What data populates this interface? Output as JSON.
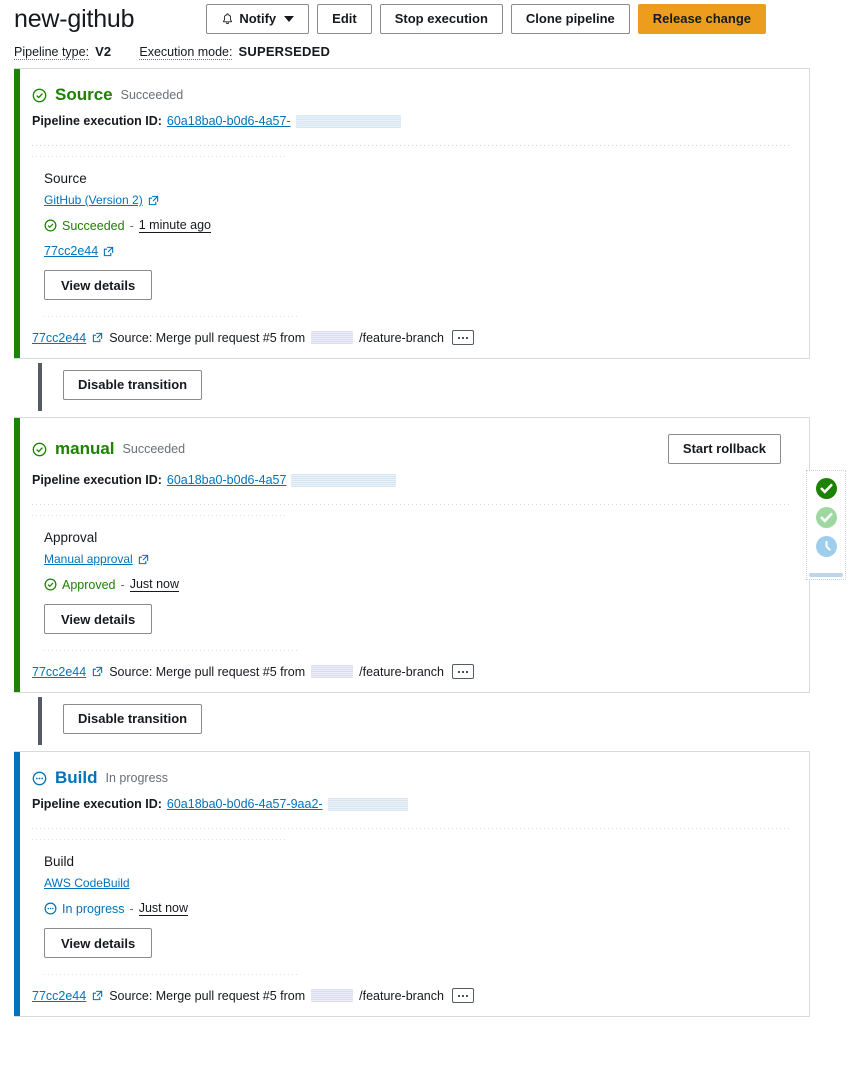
{
  "header": {
    "pipeline_name": "new-github",
    "buttons": [
      {
        "label": "Notify",
        "icon": "bell-icon",
        "caret": true
      },
      {
        "label": "Edit"
      },
      {
        "label": "Stop execution"
      },
      {
        "label": "Clone pipeline"
      },
      {
        "label": "Release change",
        "variant": "primary",
        "color": "#ec9d1d"
      }
    ],
    "meta": {
      "pipeline_type_label": "Pipeline type:",
      "pipeline_type_value": "V2",
      "execution_mode_label": "Execution mode:",
      "execution_mode_value": "SUPERSEDED"
    }
  },
  "colors": {
    "success": "#1d8102",
    "in_progress": "#0073bb",
    "link": "#0073bb",
    "primary_button": "#ec9d1d",
    "muted": "#687078"
  },
  "stages": [
    {
      "name": "Source",
      "status": "Succeeded",
      "state": "success",
      "exec_id_label": "Pipeline execution ID:",
      "exec_id_value": "60a18ba0-b0d6-4a57-",
      "exec_id_redacted_width": 105,
      "action": {
        "name": "Source",
        "provider": "GitHub (Version 2)",
        "provider_external_link": true,
        "status": "Succeeded",
        "status_state": "success",
        "timestamp": "1 minute ago",
        "commit": "77cc2e44",
        "details_button": "View details"
      },
      "footer": {
        "commit": "77cc2e44",
        "message_prefix": "Source: Merge pull request #5 from",
        "redacted_width": 42,
        "message_suffix": "/feature-branch",
        "overflow_menu": "•••"
      }
    },
    {
      "name": "manual",
      "status": "Succeeded",
      "state": "success",
      "exec_id_label": "Pipeline execution ID:",
      "exec_id_value": "60a18ba0-b0d6-4a57",
      "exec_id_redacted_width": 105,
      "rollback_button": "Start rollback",
      "action": {
        "name": "Approval",
        "provider": "Manual approval",
        "provider_external_link": true,
        "status": "Approved",
        "status_state": "success",
        "timestamp": "Just now",
        "details_button": "View details"
      },
      "footer": {
        "commit": "77cc2e44",
        "message_prefix": "Source: Merge pull request #5 from",
        "redacted_width": 42,
        "message_suffix": "/feature-branch",
        "overflow_menu": "•••"
      }
    },
    {
      "name": "Build",
      "status": "In progress",
      "state": "in_progress",
      "exec_id_label": "Pipeline execution ID:",
      "exec_id_value": "60a18ba0-b0d6-4a57-9aa2-",
      "exec_id_redacted_width": 80,
      "action": {
        "name": "Build",
        "provider": "AWS CodeBuild",
        "provider_external_link": false,
        "status": "In progress",
        "status_state": "in_progress",
        "timestamp": "Just now",
        "details_button": "View details"
      },
      "footer": {
        "commit": "77cc2e44",
        "message_prefix": "Source: Merge pull request #5 from",
        "redacted_width": 42,
        "message_suffix": "/feature-branch",
        "overflow_menu": "•••"
      }
    }
  ],
  "transitions": [
    {
      "label": "Disable transition"
    },
    {
      "label": "Disable transition"
    }
  ],
  "minimap": {
    "dots": [
      {
        "state": "succeeded",
        "color": "#1d8102"
      },
      {
        "state": "succeeded-dim",
        "color": "#9ed8a0"
      },
      {
        "state": "in-progress",
        "color": "#9fcdec"
      }
    ]
  }
}
